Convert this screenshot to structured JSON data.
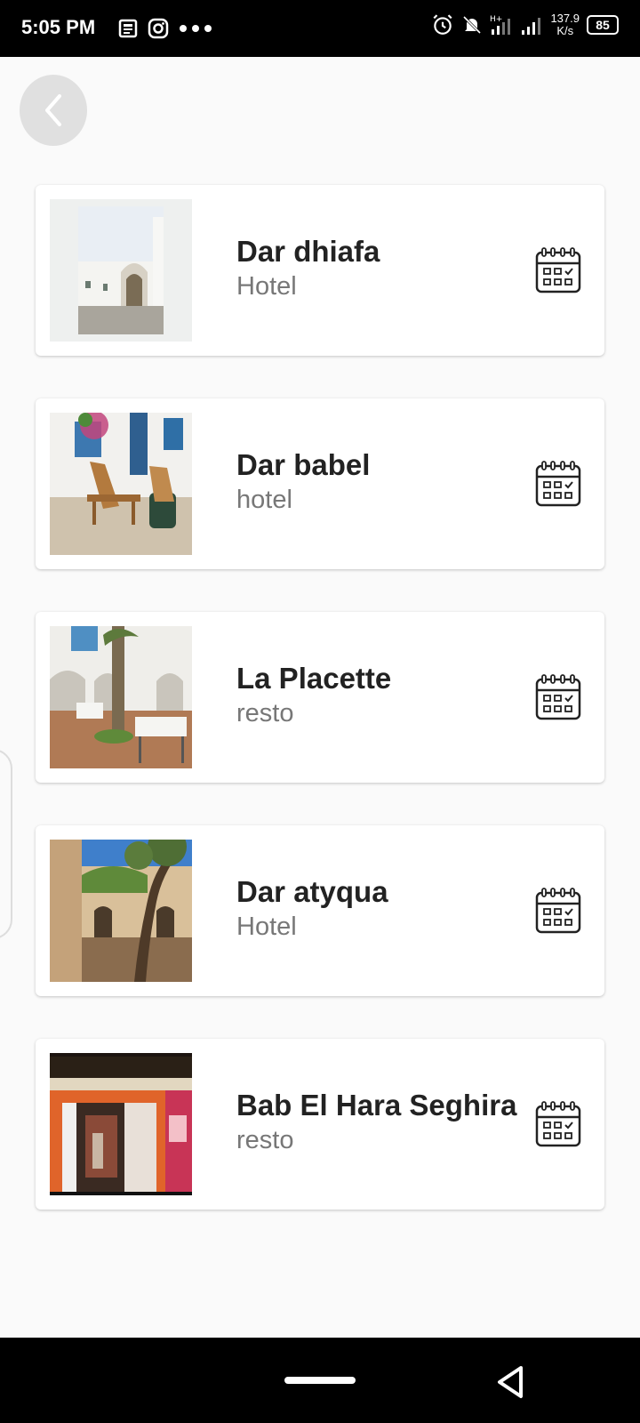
{
  "status_bar": {
    "time": "5:05 PM",
    "speed_value": "137.9",
    "speed_unit": "K/s",
    "battery": "85",
    "icons": [
      "news-icon",
      "instagram-icon",
      "more-dots-icon",
      "alarm-icon",
      "bell-off-icon",
      "signal-hplus-icon",
      "signal-icon",
      "battery-icon"
    ]
  },
  "header": {
    "back_icon": "chevron-left-icon"
  },
  "places": [
    {
      "name": "Dar dhiafa",
      "type": "Hotel"
    },
    {
      "name": "Dar babel",
      "type": "hotel"
    },
    {
      "name": "La Placette",
      "type": "resto"
    },
    {
      "name": "Dar atyqua",
      "type": "Hotel"
    },
    {
      "name": "Bab El Hara Seghira",
      "type": "resto"
    }
  ],
  "action_icon": "calendar-check-icon",
  "colors": {
    "background": "#fafafa",
    "card": "#ffffff",
    "title_text": "#222222",
    "subtitle_text": "#777777"
  }
}
